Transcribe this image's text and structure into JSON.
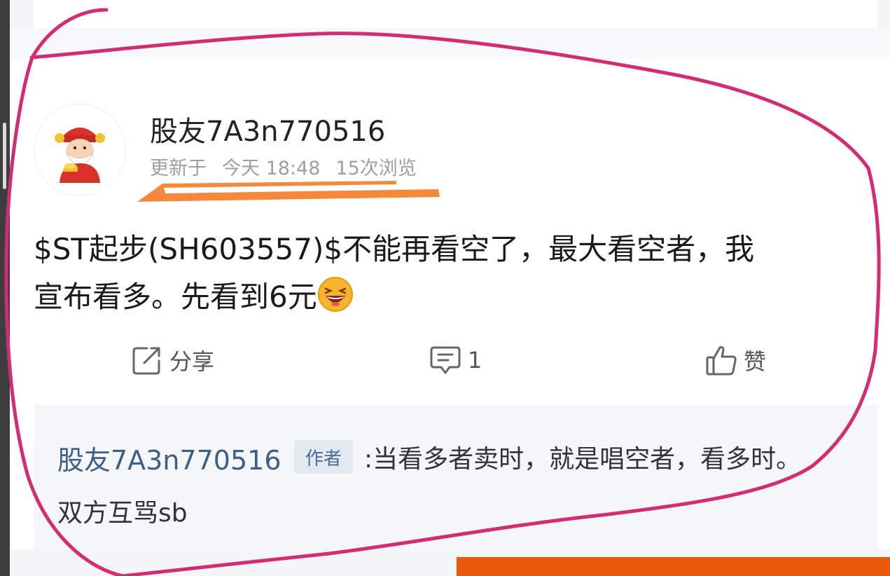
{
  "post": {
    "author": "股友7A3n770516",
    "updated_label": "更新于",
    "updated_time": "今天 18:48",
    "views": "15次浏览",
    "text_line1": "$ST起步(SH603557)$不能再看空了，最大看空者，我",
    "text_line2": "宣布看多。先看到6元",
    "emoji_icon": "laughing-face-icon"
  },
  "actions": {
    "share_label": "分享",
    "comment_count": "1",
    "like_label": "赞"
  },
  "comment": {
    "author": "股友7A3n770516",
    "badge": "作者",
    "text_line1": ":当看多者卖时，就是唱空者，看多时。",
    "text_line2": "双方互骂sb"
  },
  "colors": {
    "annotation_circle": "#d42c73",
    "annotation_underline": "#f5883a",
    "bottom_bar": "#e8590c",
    "comment_author": "#3d5e86"
  }
}
